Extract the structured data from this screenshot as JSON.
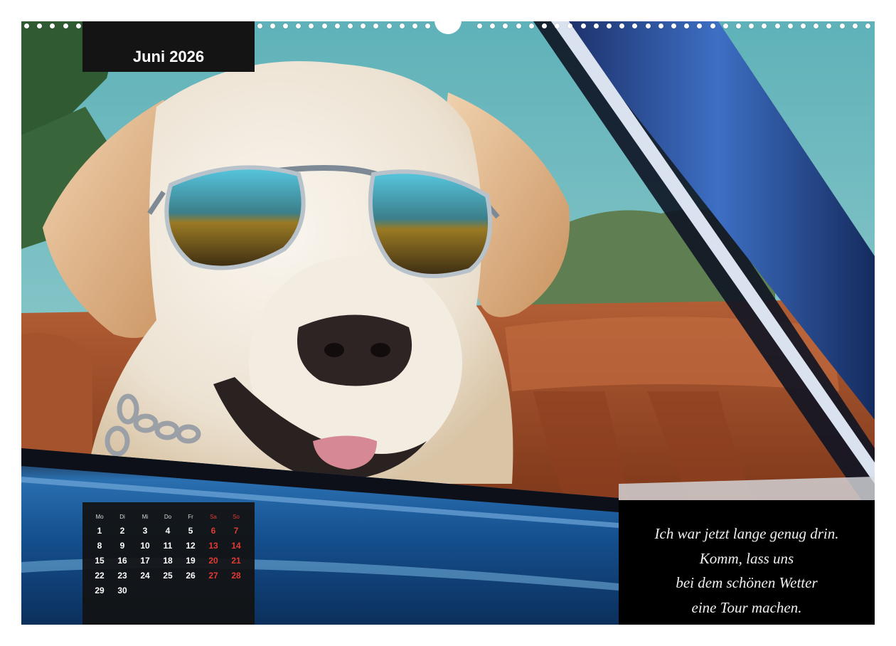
{
  "calendar": {
    "month_title": "Juni 2026",
    "weekday_headers": [
      "Mo",
      "Di",
      "Mi",
      "Do",
      "Fr",
      "Sa",
      "So"
    ],
    "weeks": [
      [
        "1",
        "2",
        "3",
        "4",
        "5",
        "6",
        "7"
      ],
      [
        "8",
        "9",
        "10",
        "11",
        "12",
        "13",
        "14"
      ],
      [
        "15",
        "16",
        "17",
        "18",
        "19",
        "20",
        "21"
      ],
      [
        "22",
        "23",
        "24",
        "25",
        "26",
        "27",
        "28"
      ],
      [
        "29",
        "30",
        "",
        "",
        "",
        "",
        ""
      ]
    ]
  },
  "quote": {
    "lines": [
      "Ich war jetzt lange genug drin.",
      "Komm, lass uns",
      "bei dem schönen Wetter",
      "eine Tour machen."
    ]
  },
  "colors": {
    "weekend": "#e03c31",
    "panel": "#141414",
    "car_blue": "#1d4f8c",
    "seat_leather": "#9a4a26"
  }
}
